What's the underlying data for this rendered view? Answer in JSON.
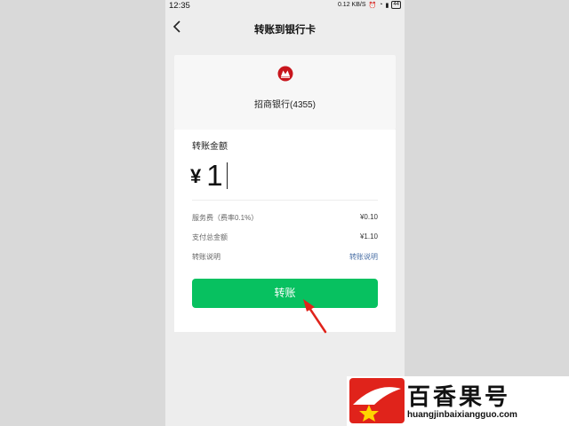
{
  "status_bar": {
    "time": "12:35",
    "net_speed": "0.12 KB/S",
    "battery": "44"
  },
  "header": {
    "title": "转账到银行卡",
    "back_icon": "chevron-left-icon"
  },
  "bank": {
    "logo_icon": "cmb-bank-logo",
    "name": "招商银行(4355)"
  },
  "amount_section": {
    "label": "转账金额",
    "currency": "¥",
    "value": "1"
  },
  "details": [
    {
      "label": "服务费（费率0.1%）",
      "value": "¥0.10"
    },
    {
      "label": "支付总金额",
      "value": "¥1.10"
    },
    {
      "label": "转账说明",
      "value": "转账说明"
    }
  ],
  "submit_button": {
    "label": "转账"
  },
  "colors": {
    "accent_green": "#07c160",
    "link_blue": "#4a6fa5",
    "annotation_red": "#e0231b"
  },
  "watermark": {
    "name": "百香果号",
    "url": "huangjinbaixiangguo.com"
  }
}
